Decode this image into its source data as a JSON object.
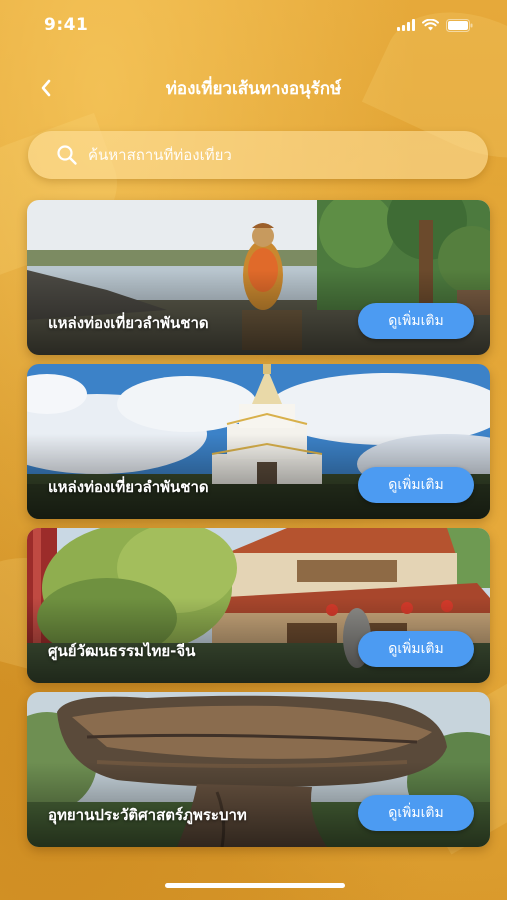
{
  "status_bar": {
    "time": "9:41"
  },
  "header": {
    "title": "ท่องเที่ยวเส้นทางอนุรักษ์"
  },
  "search": {
    "placeholder": "ค้นหาสถานที่ท่องเที่ยว"
  },
  "places": [
    {
      "title": "แหล่งท่องเที่ยวลำพันชาด",
      "button_label": "ดูเพิ่มเติม",
      "image": "lake-statue"
    },
    {
      "title": "แหล่งท่องเที่ยวลำพันชาด",
      "button_label": "ดูเพิ่มเติม",
      "image": "white-stupa"
    },
    {
      "title": "ศูนย์วัฒนธรรมไทย-จีน",
      "button_label": "ดูเพิ่มเติม",
      "image": "chinese-building"
    },
    {
      "title": "อุทยานประวัติศาสตร์ภูพระบาท",
      "button_label": "ดูเพิ่มเติม",
      "image": "balanced-rock"
    }
  ],
  "colors": {
    "background": "#DFA234",
    "button": "#4C9BF2",
    "text": "#FFFFFF"
  },
  "icons": [
    "signal-icon",
    "wifi-icon",
    "battery-icon",
    "back-arrow-icon",
    "search-icon"
  ]
}
